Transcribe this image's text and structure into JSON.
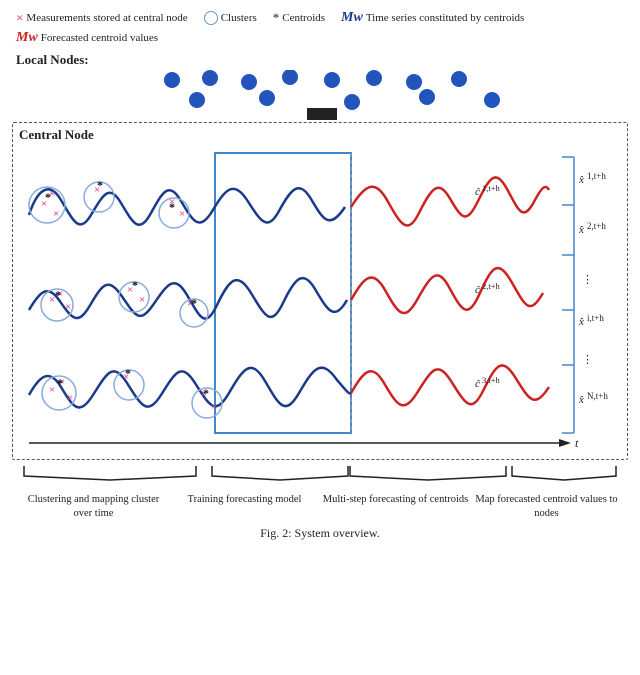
{
  "legend": {
    "items": [
      {
        "id": "measurements",
        "symbol": "× Measurements stored at central node"
      },
      {
        "id": "clusters",
        "symbol": "Clusters"
      },
      {
        "id": "centroids",
        "symbol": "* Centroids"
      },
      {
        "id": "timeseries_blue",
        "label": "Time series constituted by centroids"
      },
      {
        "id": "timeseries_red",
        "label": "Forecasted centroid values"
      }
    ]
  },
  "local_nodes_label": "Local Nodes:",
  "central_node_label": "Central Node",
  "bottom_labels": [
    "Clustering and mapping cluster over time",
    "Training forecasting model",
    "Multi-step forecasting of centroids",
    "Map forecasted centroid values to nodes"
  ],
  "fig_caption": "Fig. 2: System overview.",
  "centroid_labels": [
    "ĉ₁,t+h",
    "ĉ₂,t+h",
    "ĉ₃,t+h"
  ],
  "x_labels": [
    "x̂₁,t+h",
    "x̂₂,t+h",
    "x̂ᵢ,t+h",
    "x̂N,t+h"
  ],
  "t_label": "t"
}
